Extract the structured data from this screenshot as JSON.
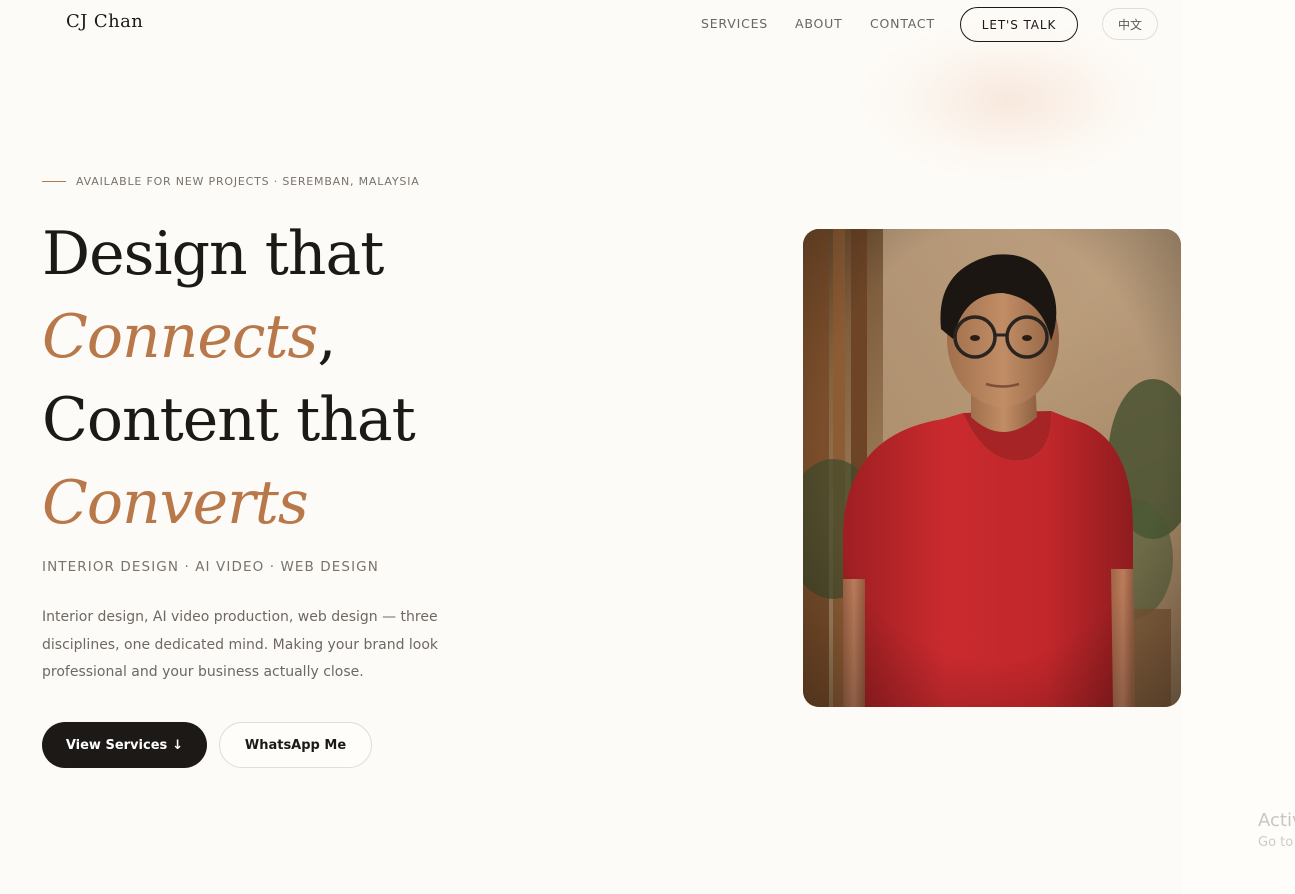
{
  "nav": {
    "brand": "CJ Chan",
    "links": [
      "SERVICES",
      "ABOUT",
      "CONTACT"
    ],
    "cta_label": "LET'S TALK",
    "lang_label": "中文"
  },
  "hero": {
    "eyebrow": "AVAILABLE FOR NEW PROJECTS · SEREMBAN, MALAYSIA",
    "headline": {
      "line1": "Design that",
      "accent1": "Connects",
      "comma": ",",
      "line3": "Content that",
      "accent2": "Converts"
    },
    "disciplines": "INTERIOR DESIGN · AI VIDEO · WEB DESIGN",
    "description": "Interior design, AI video production, web design — three disciplines, one dedicated mind. Making your brand look professional and your business actually close.",
    "primary_button": "View Services",
    "primary_button_icon": "↓",
    "secondary_button": "WhatsApp Me"
  },
  "portrait": {
    "icon": "portrait-photo"
  },
  "watermark": {
    "title": "Activ",
    "subtitle": "Go to"
  },
  "colors": {
    "background": "#fdfbf7",
    "text": "#1c1917",
    "accent": "#b8784a",
    "muted": "#7a726b",
    "shirt": "#c2272b"
  }
}
